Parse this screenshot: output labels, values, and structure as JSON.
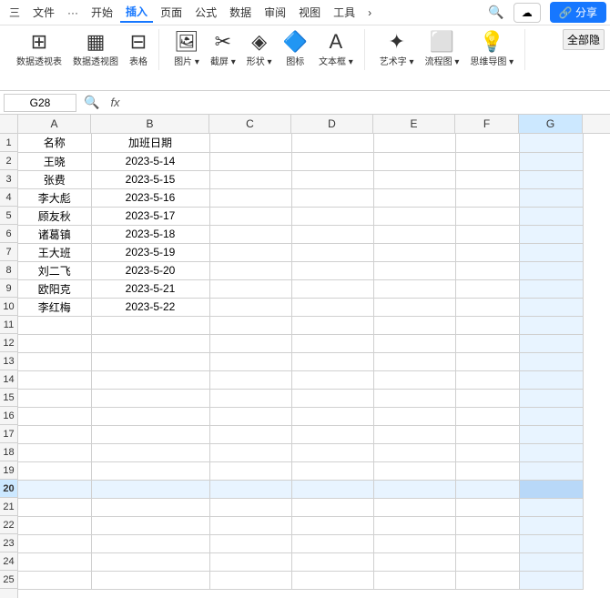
{
  "menubar": {
    "items": [
      "三",
      "文件",
      "···",
      "开始",
      "插入",
      "页面",
      "公式",
      "数据",
      "审阅",
      "视图",
      "工具",
      "›"
    ],
    "search_icon": "🔍",
    "cloud_label": "☁",
    "share_label": "🔗 分享"
  },
  "ribbon": {
    "tab_active": "插入",
    "groups": [
      {
        "icons": [
          {
            "sym": "⊞",
            "label": "数据透视表"
          },
          {
            "sym": "▦",
            "label": "数据透视图"
          },
          {
            "sym": "⊟",
            "label": "表格"
          }
        ]
      },
      {
        "icons": [
          {
            "sym": "🖼",
            "label": "图片▾"
          },
          {
            "sym": "⌛",
            "label": "截屏▾"
          },
          {
            "sym": "◈",
            "label": "形状▾"
          },
          {
            "sym": "🔷",
            "label": "图标"
          },
          {
            "sym": "A",
            "label": "文本框▾"
          }
        ]
      },
      {
        "icons": [
          {
            "sym": "✦",
            "label": "艺术字▾"
          },
          {
            "sym": "⬜",
            "label": "流程图▾"
          },
          {
            "sym": "💡",
            "label": "思维导图▾"
          }
        ]
      },
      {
        "label": "全部隐",
        "expand": true
      }
    ]
  },
  "formula_bar": {
    "cell_ref": "G28",
    "zoom_icon": "🔍",
    "fx": "fx"
  },
  "spreadsheet": {
    "columns": [
      "A",
      "B",
      "C",
      "D",
      "E",
      "F",
      "G"
    ],
    "active_column": "G",
    "active_row": 28,
    "header_row": {
      "a": "名称",
      "b": "加班日期"
    },
    "data_rows": [
      {
        "row": 2,
        "a": "王晓",
        "b": "2023-5-14"
      },
      {
        "row": 3,
        "a": "张费",
        "b": "2023-5-15"
      },
      {
        "row": 4,
        "a": "李大彪",
        "b": "2023-5-16"
      },
      {
        "row": 5,
        "a": "顾友秋",
        "b": "2023-5-17"
      },
      {
        "row": 6,
        "a": "诸葛镇",
        "b": "2023-5-18"
      },
      {
        "row": 7,
        "a": "王大班",
        "b": "2023-5-19"
      },
      {
        "row": 8,
        "a": "刘二飞",
        "b": "2023-5-20"
      },
      {
        "row": 9,
        "a": "欧阳克",
        "b": "2023-5-21"
      },
      {
        "row": 10,
        "a": "李红梅",
        "b": "2023-5-22"
      }
    ],
    "empty_rows": [
      11,
      12,
      13,
      14,
      15,
      16,
      17,
      18,
      19,
      20,
      21,
      22,
      23,
      24,
      25
    ],
    "colors": {
      "header_bg": "#ff8c00",
      "header_text": "#ffffff",
      "selected_col": "#e8f4ff",
      "grid_line": "#d0d0d0"
    }
  }
}
